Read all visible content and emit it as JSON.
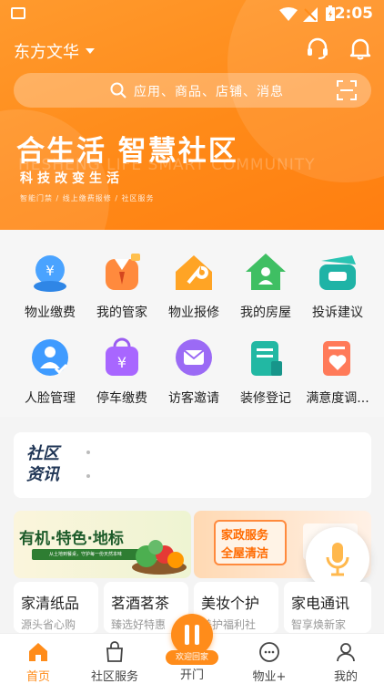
{
  "status_bar": {
    "time": "2:05"
  },
  "header": {
    "location": "东方文华",
    "search_placeholder": "应用、商品、店铺、消息"
  },
  "banner": {
    "slogan": "合生活 智慧社区",
    "sub_slogan": "科技改变生活",
    "english": "HESHENG LIFE SMART COMMUNITY",
    "tags": "智能门禁 / 线上缴费报修 / 社区服务"
  },
  "services": [
    {
      "label": "物业缴费",
      "icon": "property-payment-icon"
    },
    {
      "label": "我的管家",
      "icon": "housekeeper-icon"
    },
    {
      "label": "物业报修",
      "icon": "repair-icon"
    },
    {
      "label": "我的房屋",
      "icon": "house-icon"
    },
    {
      "label": "投诉建议",
      "icon": "complaint-icon"
    },
    {
      "label": "人脸管理",
      "icon": "face-icon"
    },
    {
      "label": "停车缴费",
      "icon": "parking-icon"
    },
    {
      "label": "访客邀请",
      "icon": "visitor-icon"
    },
    {
      "label": "装修登记",
      "icon": "decoration-icon"
    },
    {
      "label": "满意度调...",
      "icon": "survey-icon"
    }
  ],
  "news": {
    "title_line1": "社区",
    "title_line2": "资讯"
  },
  "promos": {
    "left_title": "有机·特色·地标",
    "left_sub": "从土地到餐桌，守护每一份天然本味",
    "right_title_1": "家政服务",
    "right_title_2": "全屋清洁"
  },
  "shops": [
    {
      "name": "家清纸品",
      "sub": "源头省心购"
    },
    {
      "name": "茗酒茗茶",
      "sub": "臻选好特惠"
    },
    {
      "name": "美妆个护",
      "sub": "美护福利社"
    },
    {
      "name": "家电通讯",
      "sub": "智享焕新家"
    }
  ],
  "tabbar": {
    "home": "首页",
    "community": "社区服务",
    "open": "开门",
    "welcome": "欢迎回家",
    "property": "物业+",
    "mine": "我的"
  },
  "colors": {
    "accent": "#ff8c1a",
    "hero": "#ff9a2e"
  }
}
